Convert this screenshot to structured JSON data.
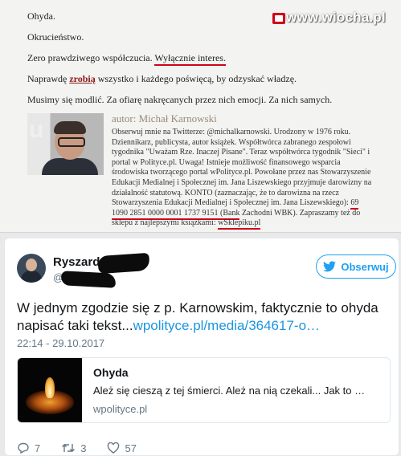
{
  "watermark": {
    "text": "www.wiocha.pl"
  },
  "article": {
    "p1": "Ohyda.",
    "p2": "Okrucieństwo.",
    "p3_a": "Zero prawdziwego współczucia. ",
    "p3_b": "Wyłącznie interes.",
    "p4_a": "Naprawdę ",
    "p4_link": "zrobią",
    "p4_b": " wszystko i każdego poświęcą, by odzyskać władzę.",
    "p5": "Musimy się modlić. Za ofiarę nakręcanych przez nich emocji. Za nich samych.",
    "author_name": "autor: Michał Karnowski",
    "bio_main": "Obserwuj mnie na Twitterze: @michalkarnowski. Urodzony w 1976 roku. Dziennikarz, publicysta, autor książek. Współtwórca zabranego zespołowi tygodnika \"Uważam Rze. Inaczej Pisane\". Teraz współtwórca tygodnik \"Sieci\" i portal w Polityce.pl. Uwaga! Istnieje możliwość finansowego wsparcia środowiska tworzącego portal wPolityce.pl. Powołane przez nas Stowarzyszenie Edukacji Medialnej i Społecznej im. Jana Liszewskiego przyjmuje darowizny na działalność statutową. KONTO (zaznaczając, że to darowizna na rzecz Stowarzyszenia Edukacji Medialnej i Społecznej im. Jana Liszewskiego): ",
    "bio_account": "69 1090 2851 0000 0001 1737 9151 (Bank",
    "bio_mid": " Zachodni WBK). Zapraszamy też do sklepu z najlepszymi książkami: ",
    "bio_shop": "wSklepiku.pl"
  },
  "tweet": {
    "user_name": "Ryszard",
    "user_handle": "@",
    "follow_label": "Obserwuj",
    "text_main": "W jednym zgodzie się z p. Karnowskim, faktycznie to ohyda napisać taki tekst...",
    "text_link": "wpolityce.pl/media/364617-o…",
    "timestamp": "22:14 - 29.10.2017",
    "card": {
      "title": "Ohyda",
      "description": "Ależ się cieszą z tej śmierci. Ależ na nią czekali... Jak to …",
      "domain": "wpolityce.pl"
    },
    "actions": {
      "replies": "7",
      "retweets": "3",
      "likes": "57"
    }
  },
  "colors": {
    "twitter_blue": "#1da1f2",
    "red_underline": "#d0021b"
  }
}
